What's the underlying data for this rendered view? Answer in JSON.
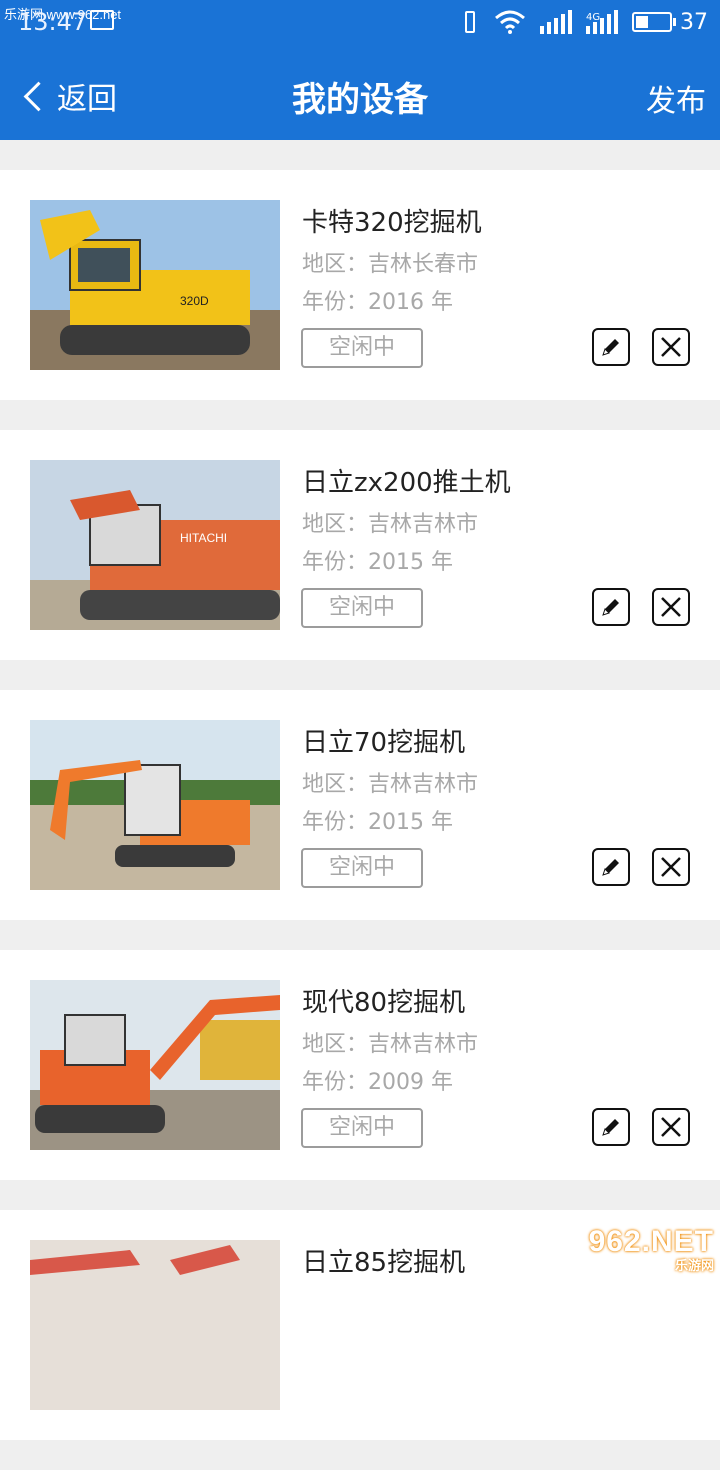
{
  "status_bar": {
    "time": "13:47",
    "watermark": "乐游网 www.962.net",
    "battery_level": "37",
    "battery_fraction": 0.37,
    "network_label": "4G"
  },
  "navbar": {
    "back_label": "返回",
    "title": "我的设备",
    "publish_label": "发布"
  },
  "equipment": [
    {
      "name": "卡特320挖掘机",
      "region": "地区：吉林长春市",
      "year": "年份：2016 年",
      "status": "空闲中",
      "photo": "yellow-excavator"
    },
    {
      "name": "日立zx200推土机",
      "region": "地区：吉林吉林市",
      "year": "年份：2015 年",
      "status": "空闲中",
      "photo": "orange-excavator"
    },
    {
      "name": "日立70挖掘机",
      "region": "地区：吉林吉林市",
      "year": "年份：2015 年",
      "status": "空闲中",
      "photo": "orange-excavator"
    },
    {
      "name": "现代80挖掘机",
      "region": "地区：吉林吉林市",
      "year": "年份：2009 年",
      "status": "空闲中",
      "photo": "orange-excavator"
    },
    {
      "name": "日立85挖掘机",
      "region": "",
      "year": "",
      "status": "",
      "photo": "orange-excavator"
    }
  ],
  "bottom_watermark": {
    "big": "962.NET",
    "small": "乐游网"
  },
  "colors": {
    "brand_blue": "#1a73d6",
    "divider": "#efefef",
    "muted_text": "#a8a8a8"
  },
  "icons": [
    "chevron-left-icon",
    "edit-icon",
    "delete-icon",
    "wifi-icon",
    "signal-icon",
    "battery-icon",
    "vibrate-icon",
    "image-icon"
  ]
}
